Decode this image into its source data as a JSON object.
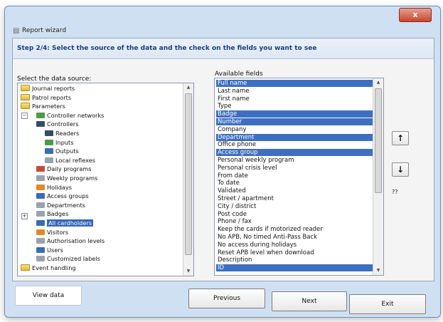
{
  "window": {
    "title": "Report wizard",
    "close_label": "x"
  },
  "step": {
    "text": "Step 2/4: Select the source of the data and the check on the fields you want to see"
  },
  "labels": {
    "source": "Select the data source:",
    "fields": "Available fields",
    "unknown": "??"
  },
  "tree": [
    {
      "label": "Journal reports",
      "icon": "folder-icon",
      "indent": 0,
      "selected": false
    },
    {
      "label": "Patrol reports",
      "icon": "folder-icon",
      "indent": 0,
      "selected": false
    },
    {
      "label": "Parameters",
      "icon": "folder-icon",
      "indent": 0,
      "selected": false
    },
    {
      "label": "Controller networks",
      "icon": "network-icon",
      "indent": 1,
      "selected": false
    },
    {
      "label": "Controllers",
      "icon": "controller-icon",
      "indent": 1,
      "selected": false
    },
    {
      "label": "Readers",
      "icon": "reader-icon",
      "indent": 2,
      "selected": false
    },
    {
      "label": "Inputs",
      "icon": "input-icon",
      "indent": 2,
      "selected": false
    },
    {
      "label": "Outputs",
      "icon": "output-icon",
      "indent": 2,
      "selected": false
    },
    {
      "label": "Local reflexes",
      "icon": "reflex-icon",
      "indent": 2,
      "selected": false
    },
    {
      "label": "Daily programs",
      "icon": "calendar-icon",
      "indent": 1,
      "selected": false
    },
    {
      "label": "Weekly programs",
      "icon": "weekly-icon",
      "indent": 1,
      "selected": false
    },
    {
      "label": "Holidays",
      "icon": "holiday-icon",
      "indent": 1,
      "selected": false
    },
    {
      "label": "Access groups",
      "icon": "group-icon",
      "indent": 1,
      "selected": false
    },
    {
      "label": "Departments",
      "icon": "department-icon",
      "indent": 1,
      "selected": false
    },
    {
      "label": "Badges",
      "icon": "badge-icon",
      "indent": 1,
      "selected": false
    },
    {
      "label": "All cardholders",
      "icon": "cardholders-icon",
      "indent": 1,
      "selected": true
    },
    {
      "label": "Visitors",
      "icon": "visitor-icon",
      "indent": 1,
      "selected": false
    },
    {
      "label": "Authorisation levels",
      "icon": "authorization-icon",
      "indent": 1,
      "selected": false
    },
    {
      "label": "Users",
      "icon": "user-icon",
      "indent": 1,
      "selected": false
    },
    {
      "label": "Customized labels",
      "icon": "label-icon",
      "indent": 1,
      "selected": false
    },
    {
      "label": "Event handling",
      "icon": "folder-icon",
      "indent": 0,
      "selected": false
    }
  ],
  "fields": [
    {
      "label": "Full name",
      "selected": true
    },
    {
      "label": "Last name",
      "selected": false
    },
    {
      "label": "First name",
      "selected": false
    },
    {
      "label": "Type",
      "selected": false
    },
    {
      "label": "Badge",
      "selected": true
    },
    {
      "label": "Number",
      "selected": true
    },
    {
      "label": "Company",
      "selected": false
    },
    {
      "label": "Department",
      "selected": true
    },
    {
      "label": "Office phone",
      "selected": false
    },
    {
      "label": "Access group",
      "selected": true
    },
    {
      "label": "Personal weekly program",
      "selected": false
    },
    {
      "label": "Personal crisis level",
      "selected": false
    },
    {
      "label": "From date",
      "selected": false
    },
    {
      "label": "To date",
      "selected": false
    },
    {
      "label": "Validated",
      "selected": false
    },
    {
      "label": "Street / apartment",
      "selected": false
    },
    {
      "label": "City / district",
      "selected": false
    },
    {
      "label": "Post code",
      "selected": false
    },
    {
      "label": "Phone / fax",
      "selected": false
    },
    {
      "label": "Keep the cards if motorized reader",
      "selected": false
    },
    {
      "label": "No APB, No timed Anti-Pass Back",
      "selected": false
    },
    {
      "label": "No access during holidays",
      "selected": false
    },
    {
      "label": "Reset APB level when download",
      "selected": false
    },
    {
      "label": "Description",
      "selected": false
    },
    {
      "label": "ID",
      "selected": true
    }
  ],
  "buttons": {
    "move_up": "↑",
    "move_down": "↓",
    "view_data": "View data",
    "previous": "Previous",
    "next": "Next",
    "exit": "Exit"
  },
  "colors": {
    "selection": "#3e6fbf",
    "window_bg": "#cfe0f3",
    "step_text": "#1c3f7a"
  }
}
